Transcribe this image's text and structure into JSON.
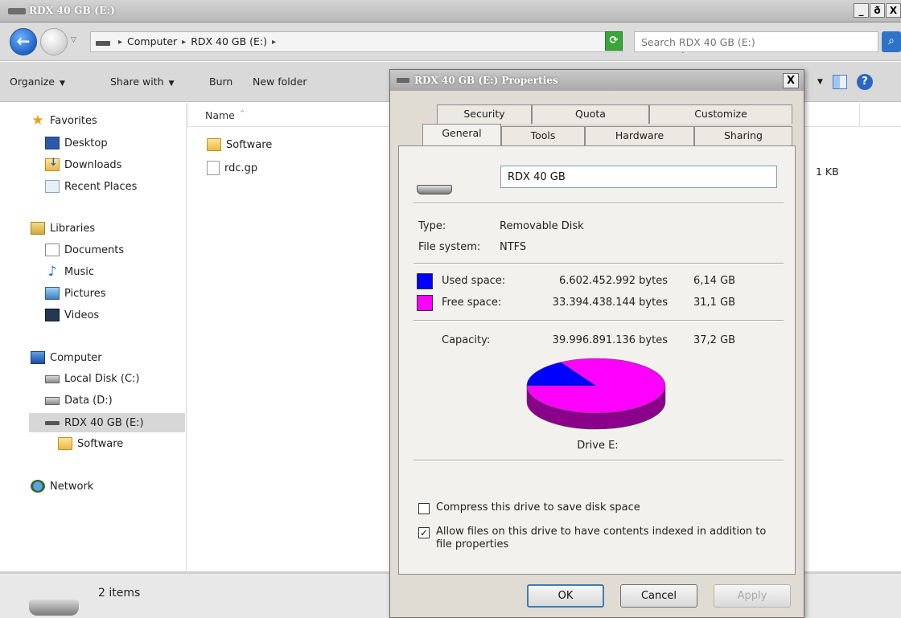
{
  "explorer": {
    "window_title": "RDX 40 GB (E:)",
    "window_buttons": [
      "_",
      "ð",
      "X"
    ],
    "breadcrumb": [
      "Computer",
      "RDX 40 GB (E:)"
    ],
    "search_placeholder": "Search RDX 40 GB (E:)",
    "toolbar": {
      "organize": "Organize",
      "share_with": "Share with",
      "burn": "Burn",
      "new_folder": "New folder"
    },
    "nav": {
      "favorites": "Favorites",
      "desktop": "Desktop",
      "downloads": "Downloads",
      "recent_places": "Recent Places",
      "libraries": "Libraries",
      "documents": "Documents",
      "music": "Music",
      "pictures": "Pictures",
      "videos": "Videos",
      "computer": "Computer",
      "local_disk": "Local Disk (C:)",
      "data": "Data (D:)",
      "rdx": "RDX 40 GB (E:)",
      "software": "Software",
      "network": "Network"
    },
    "column_name": "Name",
    "files": [
      {
        "name": "Software",
        "size": ""
      },
      {
        "name": "rdc.gp",
        "size": "1 KB"
      }
    ],
    "status": "2 items"
  },
  "dialog": {
    "title": "RDX 40 GB (E:) Properties",
    "close": "X",
    "tabs_row1": [
      "Security",
      "Quota",
      "Customize"
    ],
    "tabs_row2": [
      "General",
      "Tools",
      "Hardware",
      "Sharing"
    ],
    "volume_name": "RDX 40 GB",
    "type_label": "Type:",
    "type_value": "Removable Disk",
    "fs_label": "File system:",
    "fs_value": "NTFS",
    "used_label": "Used space:",
    "used_bytes": "6.602.452.992 bytes",
    "used_gb": "6,14 GB",
    "free_label": "Free space:",
    "free_bytes": "33.394.438.144 bytes",
    "free_gb": "31,1 GB",
    "capacity_label": "Capacity:",
    "capacity_bytes": "39.996.891.136 bytes",
    "capacity_gb": "37,2 GB",
    "drive_label": "Drive E:",
    "compress_label": "Compress this drive to save disk space",
    "compress_checked": false,
    "index_label": "Allow files on this drive to have contents indexed in addition to file properties",
    "index_checked": true,
    "buttons": {
      "ok": "OK",
      "cancel": "Cancel",
      "apply": "Apply"
    },
    "colors": {
      "used": "#0000ff",
      "free": "#ff00ff"
    },
    "used_fraction": 0.165
  }
}
